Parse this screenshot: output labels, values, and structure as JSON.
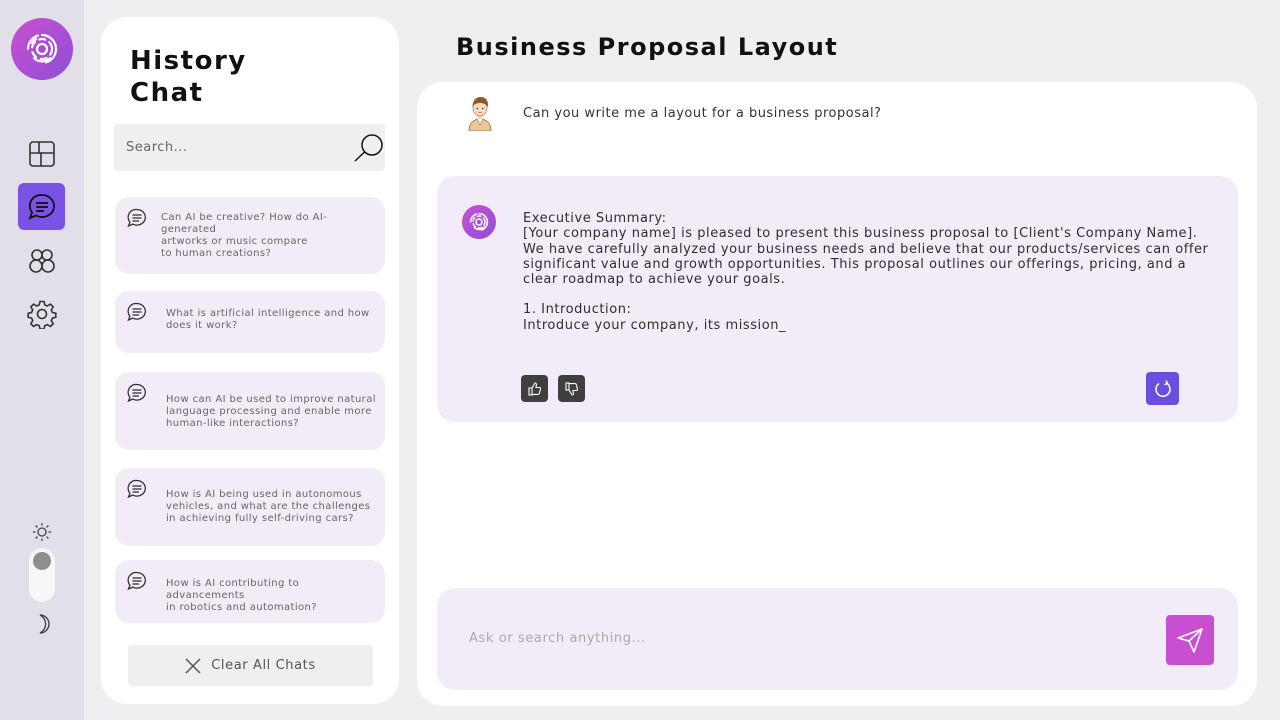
{
  "sidebar": {
    "nav": [
      {
        "name": "layout-icon",
        "active": false
      },
      {
        "name": "chat-icon",
        "active": true
      },
      {
        "name": "community-icon",
        "active": false
      },
      {
        "name": "settings-icon",
        "active": false
      }
    ],
    "theme_toggle": {
      "state": "light"
    }
  },
  "history": {
    "title_line1": "History",
    "title_line2": "Chat",
    "search_placeholder": "Search...",
    "items": [
      {
        "text": "Can AI be creative? How do AI-generated\nartworks or music compare\nto human creations?"
      },
      {
        "text": "What is artificial intelligence and how\ndoes it work?"
      },
      {
        "text": "How can AI be used to improve natural\nlanguage processing and enable more\nhuman-like interactions?"
      },
      {
        "text": "How is AI being used in autonomous\nvehicles, and what are the challenges\nin achieving fully self-driving cars?"
      },
      {
        "text": "How is AI contributing to advancements\nin robotics and automation?"
      }
    ],
    "clear_label": "Clear All Chats"
  },
  "main": {
    "title": "Business Proposal Layout",
    "user_message": "Can you write me a layout for a business proposal?",
    "bot_message": {
      "lines_a": [
        "Executive Summary:",
        "[Your company name] is pleased to present this business proposal to [Client's Company Name].",
        "We have carefully analyzed your business needs and believe that our products/services can offer",
        "significant value and growth opportunities. This proposal outlines our offerings, pricing, and a",
        "clear roadmap to achieve your goals."
      ],
      "lines_b": [
        "1. Introduction:",
        "Introduce your company, its mission_"
      ]
    },
    "composer_placeholder": "Ask or search anything..."
  },
  "colors": {
    "accent": "#7a52e6",
    "brand_gradient_start": "#c94fd1",
    "brand_gradient_end": "#8e4fd6",
    "card_bg": "#f1ecf8",
    "send": "#c94fd1",
    "regenerate": "#6b4ee0"
  }
}
